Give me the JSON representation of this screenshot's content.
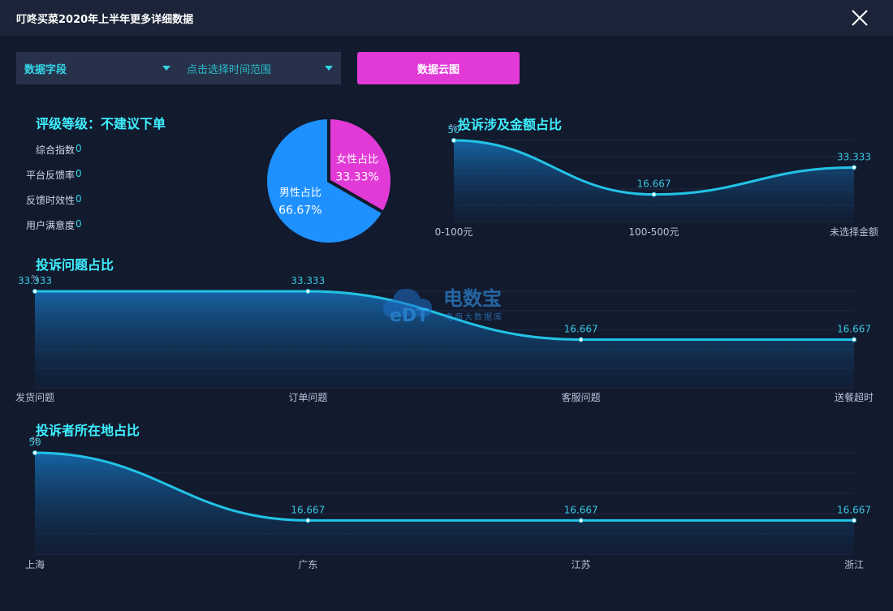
{
  "window": {
    "title": "叮咚买菜2020年上半年更多详细数据"
  },
  "filters": {
    "field_label": "数据字段",
    "time_label": "点击选择时间范围"
  },
  "cloud_button": "数据云图",
  "rating": {
    "title": "评级等级：不建议下单",
    "metrics": [
      {
        "label": "综合指数",
        "value": "0"
      },
      {
        "label": "平台反馈率",
        "value": "0"
      },
      {
        "label": "反馈时效性",
        "value": "0"
      },
      {
        "label": "用户满意度",
        "value": "0"
      }
    ]
  },
  "watermark": {
    "brand": "电数宝",
    "sub": "电商大数据库",
    "logo_text": "eDT"
  },
  "colors": {
    "pink": "#e23ad7",
    "blue": "#1e90ff",
    "cyan": "#22c3e6",
    "title": "#3ef0ff"
  },
  "chart_data": [
    {
      "type": "pie",
      "categories": [
        "女性占比",
        "男性占比"
      ],
      "values": [
        33.33,
        66.67
      ],
      "value_labels": [
        "33.33%",
        "66.67%"
      ],
      "colors": [
        "#e23ad7",
        "#1e90ff"
      ]
    },
    {
      "type": "area",
      "title": "投诉涉及金额占比",
      "ylabel": "%",
      "categories": [
        "0-100元",
        "100-500元",
        "未选择金额"
      ],
      "values": [
        50,
        16.667,
        33.333
      ],
      "value_labels": [
        "50",
        "16.667",
        "33.333"
      ],
      "ylim": [
        0,
        50
      ],
      "grid": true
    },
    {
      "type": "area",
      "title": "投诉问题占比",
      "ylabel": "%",
      "categories": [
        "发货问题",
        "订单问题",
        "客服问题",
        "送餐超时"
      ],
      "values": [
        33.333,
        33.333,
        16.667,
        16.667
      ],
      "value_labels": [
        "33.333",
        "33.333",
        "16.667",
        "16.667"
      ],
      "ylim": [
        0,
        33.333
      ],
      "grid": true
    },
    {
      "type": "area",
      "title": "投诉者所在地占比",
      "ylabel": "%",
      "categories": [
        "上海",
        "广东",
        "江苏",
        "浙江"
      ],
      "values": [
        50,
        16.667,
        16.667,
        16.667
      ],
      "value_labels": [
        "50",
        "16.667",
        "16.667",
        "16.667"
      ],
      "ylim": [
        0,
        50
      ],
      "grid": true
    }
  ]
}
